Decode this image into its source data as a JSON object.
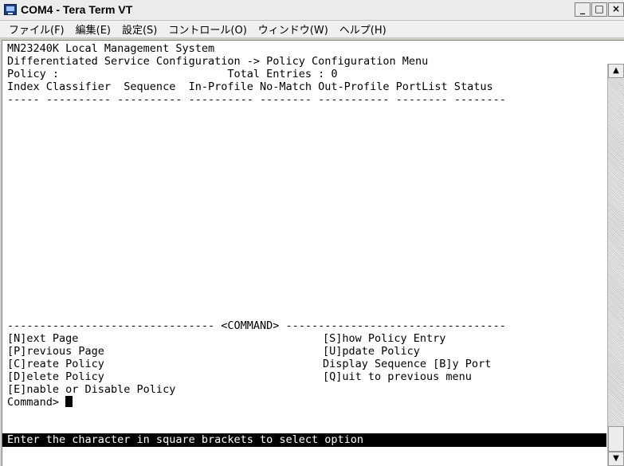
{
  "window": {
    "title": "COM4 - Tera Term VT",
    "controls": {
      "minimize": "_",
      "maximize": "□",
      "close": "×"
    }
  },
  "menubar": {
    "items": [
      {
        "label": "ファイル(F)"
      },
      {
        "label": "編集(E)"
      },
      {
        "label": "設定(S)"
      },
      {
        "label": "コントロール(O)"
      },
      {
        "label": "ウィンドウ(W)"
      },
      {
        "label": "ヘルプ(H)"
      }
    ]
  },
  "terminal": {
    "lines": [
      "MN23240K Local Management System",
      "Differentiated Service Configuration -> Policy Configuration Menu",
      "Policy :                          Total Entries : 0",
      "Index Classifier  Sequence  In-Profile No-Match Out-Profile PortList Status",
      "----- ---------- ---------- ---------- -------- ----------- -------- --------"
    ],
    "command_header": "-------------------------------- <COMMAND> ----------------------------------",
    "commands": [
      {
        "left": "[N]ext Page",
        "right": "[S]how Policy Entry"
      },
      {
        "left": "[P]revious Page",
        "right": "[U]pdate Policy"
      },
      {
        "left": "[C]reate Policy",
        "right": "Display Sequence [B]y Port"
      },
      {
        "left": "[D]elete Policy",
        "right": "[Q]uit to previous menu"
      },
      {
        "left": "[E]nable or Disable Policy",
        "right": ""
      }
    ],
    "prompt": "Command> ",
    "status_line": "Enter the character in square brackets to select option"
  },
  "scrollbar": {
    "up_arrow": "▲",
    "down_arrow": "▼",
    "position": 1.0
  },
  "colors": {
    "terminal_bg": "#ffffff",
    "terminal_fg": "#000000",
    "status_bg": "#000000",
    "status_fg": "#ffffff"
  }
}
